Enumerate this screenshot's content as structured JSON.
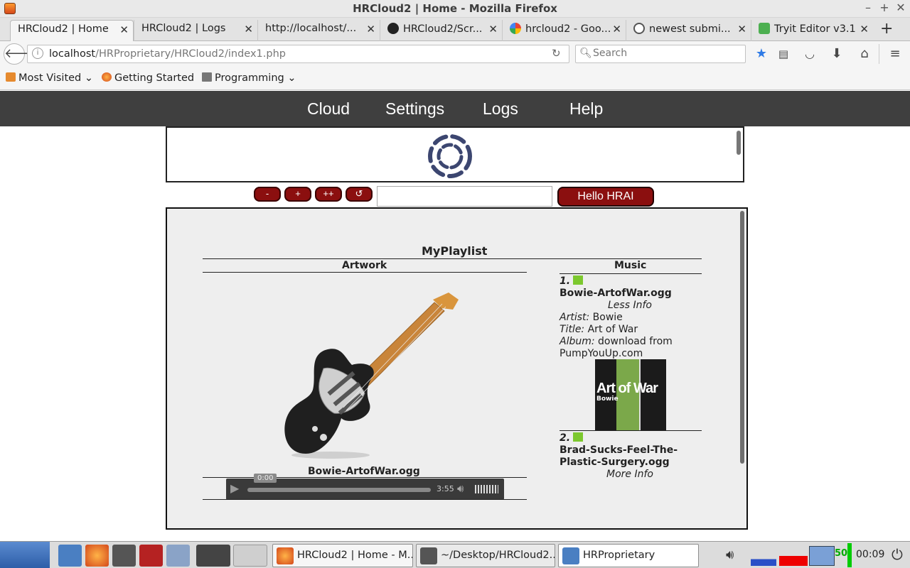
{
  "window": {
    "title": "HRCloud2 | Home - Mozilla Firefox"
  },
  "tabs": [
    {
      "label": "HRCloud2 | Home",
      "active": true
    },
    {
      "label": "HRCloud2 | Logs"
    },
    {
      "label": "http://localhost/..."
    },
    {
      "label": "HRCloud2/Scr..."
    },
    {
      "label": "hrcloud2 - Goo..."
    },
    {
      "label": "newest submi..."
    },
    {
      "label": "Tryit Editor v3.1"
    }
  ],
  "address": {
    "host": "localhost",
    "path": "/HRProprietary/HRCloud2/index1.php"
  },
  "search": {
    "placeholder": "Search"
  },
  "bookmarks": [
    "Most Visited",
    "Getting Started",
    "Programming"
  ],
  "site_nav": [
    "Cloud",
    "Settings",
    "Logs",
    "Help"
  ],
  "controls": {
    "minus": "-",
    "plus": "+",
    "plusplus": "++",
    "refresh": "↺",
    "hello": "Hello HRAI"
  },
  "playlist": {
    "title": "MyPlaylist",
    "artwork_header": "Artwork",
    "music_header": "Music",
    "now_playing": "Bowie-ArtofWar.ogg",
    "audio": {
      "current_time": "0:00",
      "duration": "3:55"
    },
    "tracks": [
      {
        "num": "1.",
        "file": "Bowie-ArtofWar.ogg",
        "toggle": "Less Info",
        "artist_label": "Artist:",
        "artist": "Bowie",
        "title_label": "Title:",
        "title": "Art of War",
        "album_label": "Album:",
        "album_l1": "download from",
        "album_l2": "PumpYouUp.com",
        "cover_title": "Art of War",
        "cover_artist": "Bowie"
      },
      {
        "num": "2.",
        "file_l1": "Brad-Sucks-Feel-The-",
        "file_l2": "Plastic-Surgery.ogg",
        "toggle": "More Info"
      }
    ]
  },
  "taskbar": {
    "windows": [
      "HRCloud2 | Home - M...",
      "~/Desktop/HRCloud2...",
      "HRProprietary"
    ],
    "battery": "50",
    "clock": "00:09"
  }
}
